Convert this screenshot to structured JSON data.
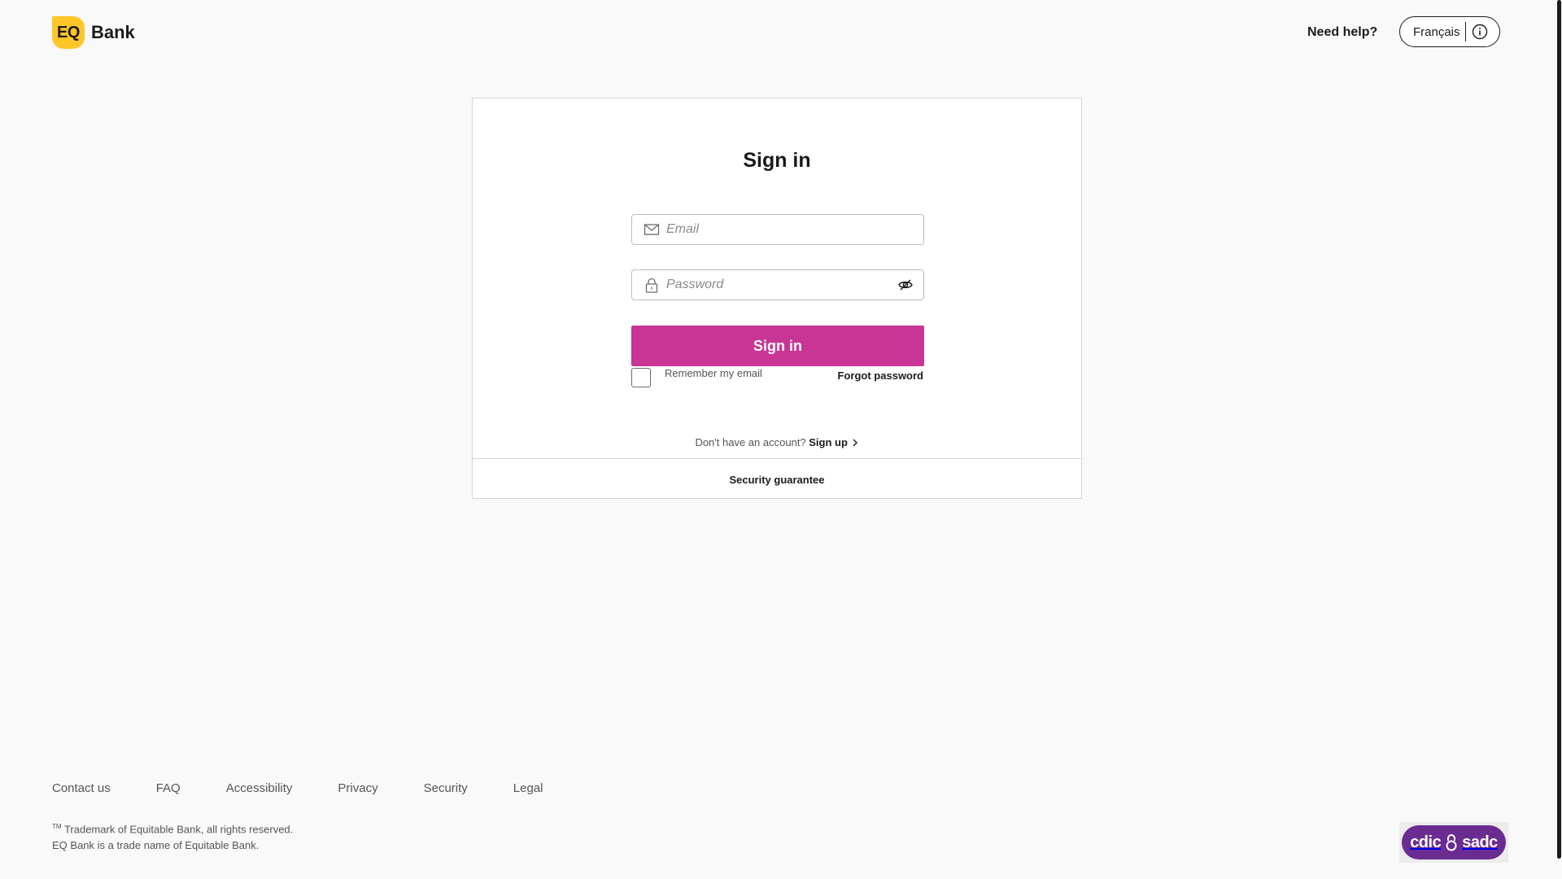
{
  "header": {
    "logo_mark": "EQ",
    "logo_text": "Bank",
    "need_help": "Need help?",
    "language_label": "Français"
  },
  "signin_card": {
    "title": "Sign in",
    "email_placeholder": "Email",
    "password_placeholder": "Password",
    "signin_button": "Sign in",
    "remember_label": "Remember my email",
    "forgot_password": "Forgot password",
    "no_account_text": "Don't have an account?",
    "signup_link": "Sign up",
    "security_guarantee": "Security guarantee"
  },
  "footer": {
    "links": [
      "Contact us",
      "FAQ",
      "Accessibility",
      "Privacy",
      "Security",
      "Legal"
    ],
    "trademark_sup": "TM",
    "trademark_text": "Trademark of Equitable Bank, all rights reserved.",
    "tradename_text": "EQ Bank is a trade name of Equitable Bank.",
    "cdic_left": "cdic",
    "cdic_right": "sadc"
  },
  "colors": {
    "primary_button": "#c93594",
    "logo_yellow": "#ffc629",
    "cdic_purple": "#6b2c91"
  },
  "icons": {
    "email_field": "envelope-icon",
    "password_field": "lock-icon",
    "password_toggle": "eye-slash-icon",
    "language_info": "info-icon",
    "signup_chevron": "chevron-right-icon"
  }
}
